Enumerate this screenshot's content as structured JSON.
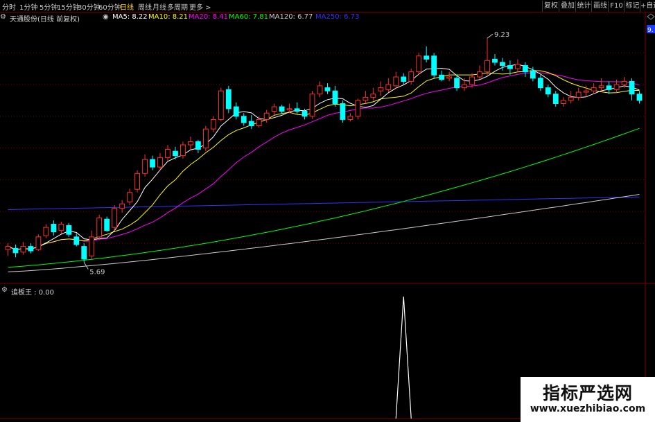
{
  "toolbar": {
    "periods": [
      "分时",
      "1分钟",
      "5分钟",
      "15分钟",
      "30分钟",
      "60分钟",
      "日线",
      "周线",
      "月线",
      "多周期",
      "更多 >"
    ],
    "active_period": "日线",
    "right_buttons": [
      "复权",
      "叠加",
      "统计",
      "画线",
      "F10",
      "标记",
      "+自选"
    ]
  },
  "main_header": {
    "stock": "天通股份(日线 前复权)",
    "ma5": "MA5: 8.22",
    "ma10": "MA10: 8.21",
    "ma20": "MA20: 8.41",
    "ma60": "MA60: 7.81",
    "ma120": "MA120: 6.77",
    "ma250": "MA250: 6.73"
  },
  "annotations": {
    "high": "9.23",
    "low": "5.69",
    "right_tag": "9."
  },
  "sub_header": {
    "indicator": "追板王 : 0.00"
  },
  "watermark": {
    "title": "指标严选网",
    "url": "www.xuezhibiao.com"
  },
  "colors": {
    "up": "#ff3030",
    "down": "#00ffff",
    "ma5": "#ffffff",
    "ma10": "#ffff00",
    "ma20": "#ff00ff",
    "ma60": "#00ff00",
    "ma120": "#cccccc",
    "ma250": "#3333ff",
    "grid": "#7f0000",
    "active": "#ffd400"
  },
  "chart_data": {
    "type": "candlestick",
    "note_units": "price (CNY)",
    "price_low": 5.69,
    "price_high": 9.23,
    "candles": [
      [
        5.9,
        5.95,
        5.8,
        6.0
      ],
      [
        5.92,
        5.85,
        5.78,
        5.98
      ],
      [
        5.86,
        5.95,
        5.82,
        6.02
      ],
      [
        5.95,
        5.88,
        5.84,
        6.0
      ],
      [
        5.9,
        6.1,
        5.88,
        6.14
      ],
      [
        6.12,
        6.25,
        6.08,
        6.3
      ],
      [
        6.3,
        6.18,
        6.12,
        6.36
      ],
      [
        6.2,
        6.3,
        6.15,
        6.34
      ],
      [
        6.28,
        6.14,
        6.1,
        6.32
      ],
      [
        6.1,
        5.98,
        5.95,
        6.16
      ],
      [
        5.95,
        5.75,
        5.7,
        6.0
      ],
      [
        5.8,
        6.1,
        5.75,
        6.2
      ],
      [
        6.1,
        6.4,
        6.05,
        6.45
      ],
      [
        6.38,
        6.2,
        6.18,
        6.42
      ],
      [
        6.25,
        6.55,
        6.2,
        6.6
      ],
      [
        6.55,
        6.62,
        6.48,
        6.68
      ],
      [
        6.65,
        6.8,
        6.6,
        6.86
      ],
      [
        6.85,
        7.1,
        6.8,
        7.15
      ],
      [
        7.1,
        7.32,
        7.05,
        7.4
      ],
      [
        7.32,
        7.2,
        7.15,
        7.38
      ],
      [
        7.2,
        7.35,
        7.15,
        7.42
      ],
      [
        7.35,
        7.48,
        7.3,
        7.55
      ],
      [
        7.45,
        7.38,
        7.32,
        7.52
      ],
      [
        7.38,
        7.55,
        7.33,
        7.6
      ],
      [
        7.55,
        7.6,
        7.48,
        7.68
      ],
      [
        7.6,
        7.48,
        7.42,
        7.63
      ],
      [
        7.5,
        7.8,
        7.45,
        7.85
      ],
      [
        7.8,
        7.95,
        7.75,
        8.0
      ],
      [
        7.95,
        8.4,
        7.92,
        8.45
      ],
      [
        8.42,
        8.12,
        8.05,
        8.48
      ],
      [
        8.15,
        8.0,
        7.95,
        8.22
      ],
      [
        8.0,
        7.9,
        7.85,
        8.05
      ],
      [
        7.92,
        7.85,
        7.8,
        8.02
      ],
      [
        7.85,
        7.95,
        7.82,
        8.0
      ],
      [
        7.95,
        8.05,
        7.9,
        8.1
      ],
      [
        8.08,
        8.15,
        8.02,
        8.2
      ],
      [
        8.15,
        8.08,
        8.03,
        8.18
      ],
      [
        8.1,
        8.12,
        8.05,
        8.2
      ],
      [
        8.12,
        8.08,
        8.04,
        8.22
      ],
      [
        8.08,
        8.0,
        7.95,
        8.12
      ],
      [
        8.0,
        8.35,
        7.96,
        8.4
      ],
      [
        8.35,
        8.48,
        8.3,
        8.55
      ],
      [
        8.45,
        8.4,
        8.35,
        8.52
      ],
      [
        8.4,
        8.2,
        8.15,
        8.48
      ],
      [
        8.2,
        7.95,
        7.9,
        8.25
      ],
      [
        7.95,
        8.0,
        7.92,
        8.05
      ],
      [
        8.0,
        8.25,
        7.95,
        8.28
      ],
      [
        8.25,
        8.3,
        8.2,
        8.4
      ],
      [
        8.3,
        8.35,
        8.25,
        8.45
      ],
      [
        8.4,
        8.45,
        8.32,
        8.55
      ],
      [
        8.42,
        8.5,
        8.38,
        8.6
      ],
      [
        8.48,
        8.62,
        8.44,
        8.7
      ],
      [
        8.62,
        8.55,
        8.5,
        8.68
      ],
      [
        8.55,
        8.7,
        8.5,
        8.75
      ],
      [
        8.7,
        8.95,
        8.65,
        9.0
      ],
      [
        8.95,
        8.9,
        8.85,
        9.1
      ],
      [
        8.95,
        8.65,
        8.6,
        9.0
      ],
      [
        8.65,
        8.58,
        8.55,
        8.72
      ],
      [
        8.6,
        8.62,
        8.55,
        8.7
      ],
      [
        8.6,
        8.45,
        8.4,
        8.66
      ],
      [
        8.45,
        8.5,
        8.4,
        8.6
      ],
      [
        8.5,
        8.62,
        8.45,
        8.68
      ],
      [
        8.62,
        8.7,
        8.58,
        8.8
      ],
      [
        8.7,
        8.88,
        8.65,
        9.23
      ],
      [
        8.9,
        8.85,
        8.8,
        8.98
      ],
      [
        8.85,
        8.8,
        8.72,
        8.92
      ],
      [
        8.8,
        8.75,
        8.65,
        8.88
      ],
      [
        8.75,
        8.82,
        8.7,
        8.9
      ],
      [
        8.8,
        8.7,
        8.62,
        8.85
      ],
      [
        8.72,
        8.6,
        8.55,
        8.78
      ],
      [
        8.6,
        8.45,
        8.4,
        8.65
      ],
      [
        8.45,
        8.35,
        8.3,
        8.5
      ],
      [
        8.35,
        8.2,
        8.15,
        8.4
      ],
      [
        8.2,
        8.25,
        8.15,
        8.3
      ],
      [
        8.25,
        8.3,
        8.2,
        8.4
      ],
      [
        8.3,
        8.38,
        8.25,
        8.45
      ],
      [
        8.38,
        8.4,
        8.3,
        8.48
      ],
      [
        8.4,
        8.45,
        8.35,
        8.52
      ],
      [
        8.45,
        8.48,
        8.4,
        8.6
      ],
      [
        8.48,
        8.42,
        8.35,
        8.55
      ],
      [
        8.42,
        8.5,
        8.38,
        8.58
      ],
      [
        8.5,
        8.55,
        8.45,
        8.62
      ],
      [
        8.55,
        8.35,
        8.25,
        8.6
      ],
      [
        8.35,
        8.25,
        8.2,
        8.4
      ]
    ],
    "indicator": {
      "name": "追板王",
      "value": 0.0,
      "spike_candle_index": 52,
      "spike_value": 1
    }
  }
}
